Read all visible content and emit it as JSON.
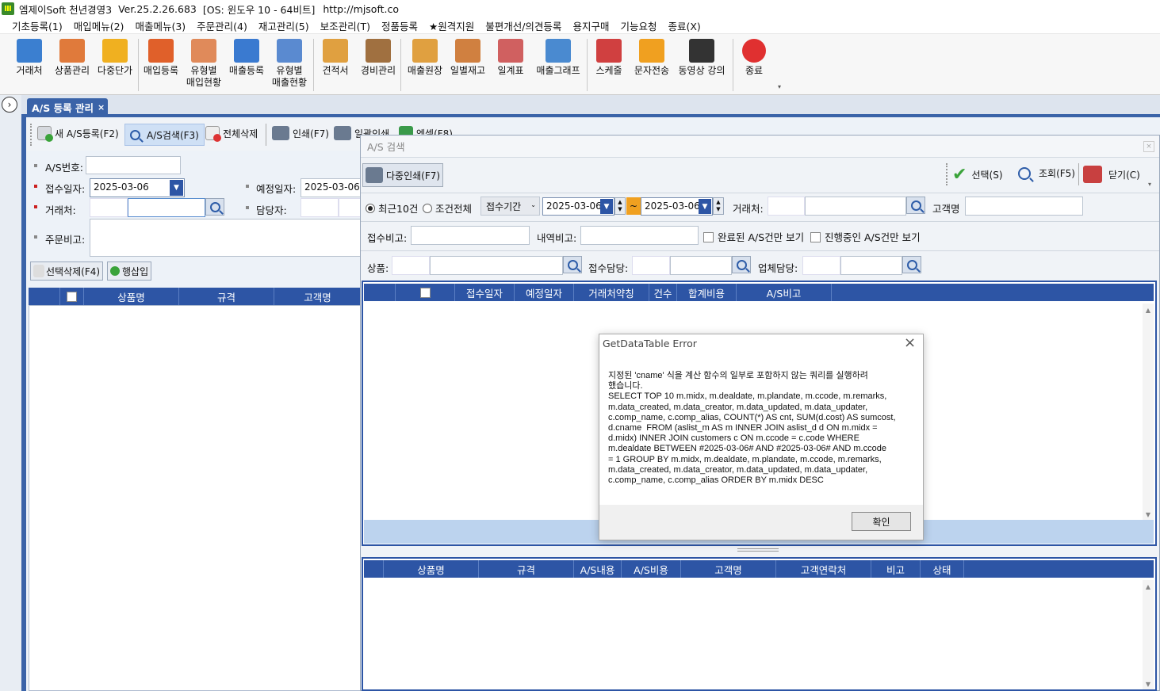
{
  "title": {
    "app_name": "엠제이Soft 천년경영3",
    "version": "Ver.25.2.26.683",
    "os": "[OS: 윈도우 10 - 64비트]",
    "url": "http://mjsoft.co"
  },
  "menu": [
    "기초등록(1)",
    "매입메뉴(2)",
    "매출메뉴(3)",
    "주문관리(4)",
    "재고관리(5)",
    "보조관리(T)",
    "정품등록",
    "★원격지원",
    "불편개선/의견등록",
    "용지구매",
    "기능요청",
    "종료(X)"
  ],
  "toolbar": [
    {
      "label": "거래처",
      "icon": "client-icon",
      "color": "#3b7fd0"
    },
    {
      "label": "상품관리",
      "icon": "product-icon",
      "color": "#e07a3b"
    },
    {
      "label": "다중단가",
      "icon": "multi-price-icon",
      "color": "#f0b020"
    },
    {
      "label": "매입등록",
      "icon": "purchase-icon",
      "color": "#e0602a"
    },
    {
      "label": "유형별\n매입현황",
      "icon": "purchase-status-icon",
      "color": "#e08a5a"
    },
    {
      "label": "매출등록",
      "icon": "sales-icon",
      "color": "#3a7ad0"
    },
    {
      "label": "유형별\n매출현황",
      "icon": "sales-status-icon",
      "color": "#5a8ad0"
    },
    {
      "label": "견적서",
      "icon": "estimate-icon",
      "color": "#e0a040"
    },
    {
      "label": "경비관리",
      "icon": "expense-icon",
      "color": "#a07040"
    },
    {
      "label": "매출원장",
      "icon": "ledger-icon",
      "color": "#e0a040"
    },
    {
      "label": "일별재고",
      "icon": "inventory-icon",
      "color": "#d08040"
    },
    {
      "label": "일계표",
      "icon": "daily-report-icon",
      "color": "#d06060"
    },
    {
      "label": "매출그래프",
      "icon": "graph-icon",
      "color": "#4a8ad0"
    },
    {
      "label": "스케줄",
      "icon": "calendar-icon",
      "color": "#d04040"
    },
    {
      "label": "문자전송",
      "icon": "sms-icon",
      "color": "#f0a020"
    },
    {
      "label": "동영상 강의",
      "icon": "video-icon",
      "color": "#333333"
    },
    {
      "label": "종료",
      "icon": "power-icon",
      "color": "#e03030"
    }
  ],
  "tab": {
    "label": "A/S 등록 관리",
    "close": "×"
  },
  "subtoolbar": {
    "new": "새 A/S등록(F2)",
    "search": "A/S검색(F3)",
    "delete_all": "전체삭제",
    "print": "인쇄(F7)",
    "batch_print": "일괄인쇄",
    "excel": "엑셀(F8)"
  },
  "form": {
    "as_no_label": "A/S번호:",
    "as_no_value": "",
    "recv_date_label": "접수일자:",
    "recv_date_value": "2025-03-06",
    "plan_date_label": "예정일자:",
    "plan_date_value": "2025-03-06",
    "client_label": "거래처:",
    "manager_label": "담당자:",
    "memo_label": "주문비고:"
  },
  "row_actions": {
    "delete_selected": "선택삭제(F4)",
    "insert_row": "행삽입"
  },
  "left_grid": {
    "columns": [
      "",
      "상품명",
      "규격",
      "고객명"
    ]
  },
  "search_dialog": {
    "title": "A/S 검색",
    "multi_print": "다중인쇄(F7)",
    "select": "선택(S)",
    "query": "조회(F5)",
    "close": "닫기(C)",
    "radio_recent": "최근10건",
    "radio_all": "조건전체",
    "period_type": "접수기간",
    "date_from": "2025-03-06",
    "date_to": "2025-03-06",
    "tilde": "~",
    "client_label": "거래처:",
    "customer_label": "고객명",
    "recv_memo_label": "접수비고:",
    "detail_memo_label": "내역비고:",
    "chk_done": "완료된 A/S건만 보기",
    "chk_progress": "진행중인 A/S건만 보기",
    "product_label": "상품:",
    "recv_manager_label": "접수담당:",
    "vendor_manager_label": "업체담당:",
    "upper_grid_columns": [
      "",
      "",
      "접수일자",
      "예정일자",
      "거래처약칭",
      "건수",
      "합계비용",
      "A/S비고"
    ],
    "lower_grid_columns": [
      "",
      "상품명",
      "규격",
      "A/S내용",
      "A/S비용",
      "고객명",
      "고객연락처",
      "비고",
      "상태"
    ]
  },
  "error_dialog": {
    "title": "GetDataTable Error",
    "close": "×",
    "message": "지정된 'cname' 식을 계산 함수의 일부로 포함하지 않는 쿼리를 실행하려\n했습니다.\nSELECT TOP 10 m.midx, m.dealdate, m.plandate, m.ccode, m.remarks,\nm.data_created, m.data_creator, m.data_updated, m.data_updater,\nc.comp_name, c.comp_alias, COUNT(*) AS cnt, SUM(d.cost) AS sumcost,\nd.cname  FROM (aslist_m AS m INNER JOIN aslist_d d ON m.midx =\nd.midx) INNER JOIN customers c ON m.ccode = c.code WHERE\nm.dealdate BETWEEN #2025-03-06# AND #2025-03-06# AND m.ccode\n= 1 GROUP BY m.midx, m.dealdate, m.plandate, m.ccode, m.remarks,\nm.data_created, m.data_creator, m.data_updated, m.data_updater,\nc.comp_name, c.comp_alias ORDER BY m.midx DESC",
    "ok": "확인"
  }
}
